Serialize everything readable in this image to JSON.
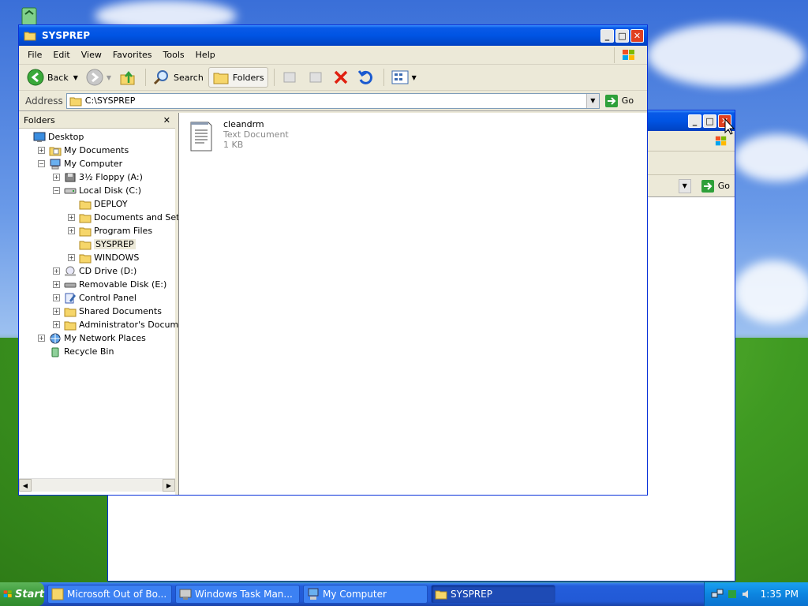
{
  "desktop": {
    "recycle_icon": "recycle-bin-icon"
  },
  "back_window": {
    "go_label": "Go",
    "controls": {
      "minimize": "_",
      "maximize": "□",
      "close": "✕"
    }
  },
  "window": {
    "title": "SYSPREP",
    "controls": {
      "minimize": "_",
      "maximize": "□",
      "close": "✕"
    },
    "menu": [
      "File",
      "Edit",
      "View",
      "Favorites",
      "Tools",
      "Help"
    ],
    "toolbar": {
      "back": "Back",
      "search": "Search",
      "folders": "Folders"
    },
    "address": {
      "label": "Address",
      "value": "C:\\SYSPREP",
      "go": "Go"
    },
    "folders_pane": {
      "title": "Folders",
      "close": "✕",
      "tree": [
        {
          "label": "Desktop",
          "icon": "desktop-icon",
          "level": 0,
          "toggle": ""
        },
        {
          "label": "My Documents",
          "icon": "my-documents-icon",
          "level": 1,
          "toggle": "+"
        },
        {
          "label": "My Computer",
          "icon": "my-computer-icon",
          "level": 1,
          "toggle": "−"
        },
        {
          "label": "3½ Floppy (A:)",
          "icon": "floppy-icon",
          "level": 2,
          "toggle": "+"
        },
        {
          "label": "Local Disk (C:)",
          "icon": "hard-disk-icon",
          "level": 2,
          "toggle": "−"
        },
        {
          "label": "DEPLOY",
          "icon": "folder-icon",
          "level": 3,
          "toggle": ""
        },
        {
          "label": "Documents and Settings",
          "icon": "folder-icon",
          "level": 3,
          "toggle": "+"
        },
        {
          "label": "Program Files",
          "icon": "folder-icon",
          "level": 3,
          "toggle": "+"
        },
        {
          "label": "SYSPREP",
          "icon": "folder-icon",
          "level": 3,
          "toggle": "",
          "selected": true
        },
        {
          "label": "WINDOWS",
          "icon": "folder-icon",
          "level": 3,
          "toggle": "+"
        },
        {
          "label": "CD Drive (D:)",
          "icon": "cd-drive-icon",
          "level": 2,
          "toggle": "+"
        },
        {
          "label": "Removable Disk (E:)",
          "icon": "removable-disk-icon",
          "level": 2,
          "toggle": "+"
        },
        {
          "label": "Control Panel",
          "icon": "control-panel-icon",
          "level": 2,
          "toggle": "+"
        },
        {
          "label": "Shared Documents",
          "icon": "folder-icon",
          "level": 2,
          "toggle": "+"
        },
        {
          "label": "Administrator's Documents",
          "icon": "folder-icon",
          "level": 2,
          "toggle": "+"
        },
        {
          "label": "My Network Places",
          "icon": "network-places-icon",
          "level": 1,
          "toggle": "+"
        },
        {
          "label": "Recycle Bin",
          "icon": "recycle-bin-icon",
          "level": 1,
          "toggle": ""
        }
      ]
    },
    "files": [
      {
        "name": "cleandrm",
        "type": "Text Document",
        "size": "1 KB",
        "icon": "text-document-icon"
      }
    ]
  },
  "taskbar": {
    "start": "Start",
    "tasks": [
      {
        "label": "Microsoft Out of Bo...",
        "icon": "oobe-icon",
        "active": false
      },
      {
        "label": "Windows Task Man...",
        "icon": "task-manager-icon",
        "active": false
      },
      {
        "label": "My Computer",
        "icon": "my-computer-icon",
        "active": false
      },
      {
        "label": "SYSPREP",
        "icon": "folder-icon",
        "active": true
      }
    ],
    "clock": "1:35 PM"
  },
  "colors": {
    "titlebar": "#0054e3",
    "window_bg": "#ece9d8",
    "taskbar": "#245edb",
    "start": "#3c9a39",
    "tray": "#0c85e0"
  }
}
